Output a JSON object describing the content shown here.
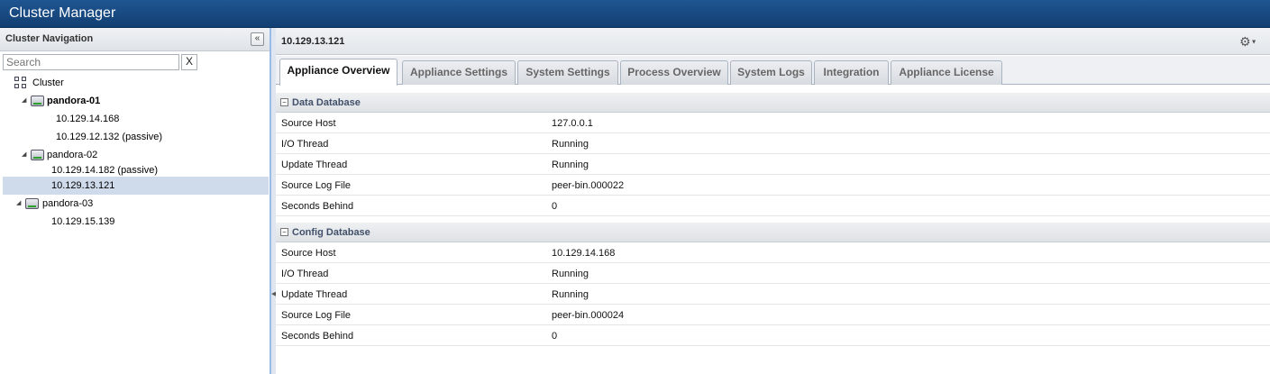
{
  "app": {
    "title": "Cluster Manager"
  },
  "nav": {
    "title": "Cluster Navigation",
    "search_placeholder": "Search",
    "clear_label": "X",
    "collapse_label": "«",
    "tree": {
      "root": "Cluster",
      "n1": "pandora-01",
      "n1_c1": "10.129.14.168",
      "n1_c2": "10.129.12.132 (passive)",
      "n2": "pandora-02",
      "n2_c1": "10.129.14.182 (passive)",
      "n2_c2": "10.129.13.121",
      "n3": "pandora-03",
      "n3_c1": "10.129.15.139"
    }
  },
  "main": {
    "host": "10.129.13.121",
    "tabs": {
      "t0": "Appliance Overview",
      "t1": "Appliance Settings",
      "t2": "System Settings",
      "t3": "Process Overview",
      "t4": "System Logs",
      "t5": "Integration",
      "t6": "Appliance License"
    },
    "data_db": {
      "title": "Data Database",
      "r0": {
        "k": "Source Host",
        "v": "127.0.0.1"
      },
      "r1": {
        "k": "I/O Thread",
        "v": "Running"
      },
      "r2": {
        "k": "Update Thread",
        "v": "Running"
      },
      "r3": {
        "k": "Source Log File",
        "v": "peer-bin.000022"
      },
      "r4": {
        "k": "Seconds Behind",
        "v": "0"
      }
    },
    "config_db": {
      "title": "Config Database",
      "r0": {
        "k": "Source Host",
        "v": "10.129.14.168"
      },
      "r1": {
        "k": "I/O Thread",
        "v": "Running"
      },
      "r2": {
        "k": "Update Thread",
        "v": "Running"
      },
      "r3": {
        "k": "Source Log File",
        "v": "peer-bin.000024"
      },
      "r4": {
        "k": "Seconds Behind",
        "v": "0"
      }
    }
  }
}
